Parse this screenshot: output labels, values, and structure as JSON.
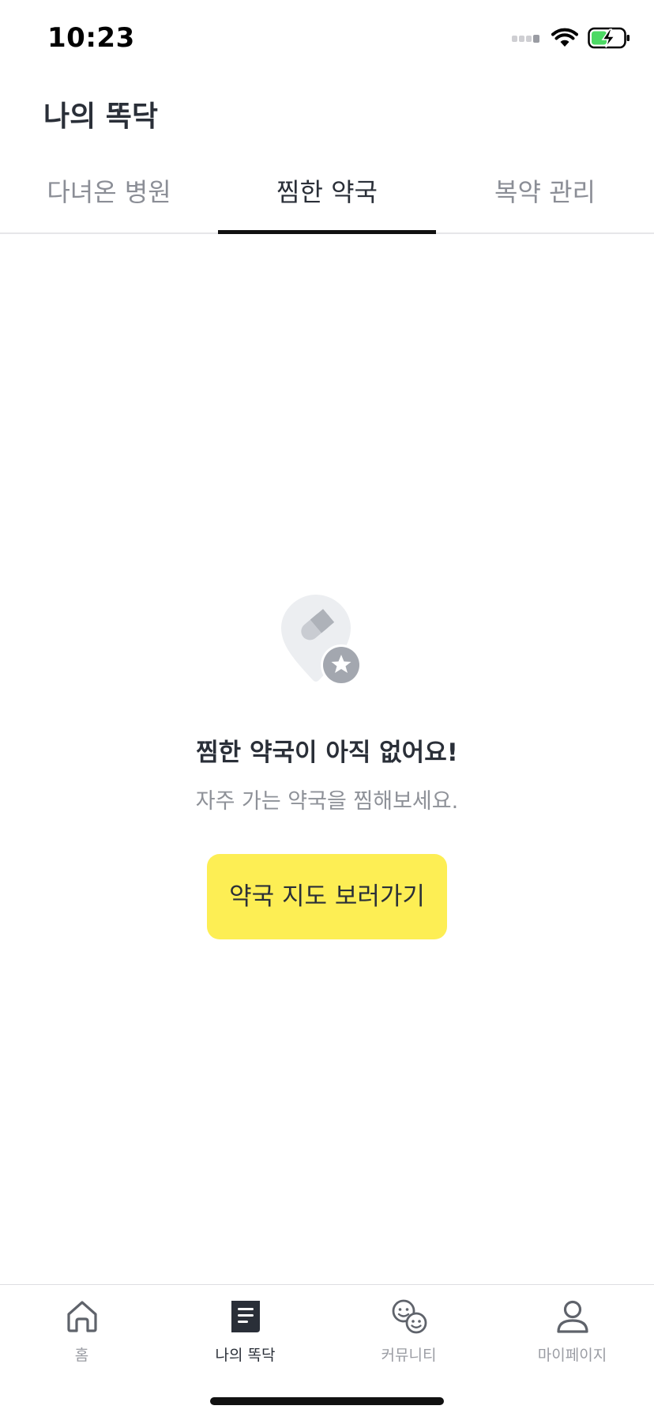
{
  "status_bar": {
    "time": "10:23"
  },
  "header": {
    "title": "나의 똑닥"
  },
  "tabs": [
    {
      "label": "다녀온 병원",
      "active": false
    },
    {
      "label": "찜한 약국",
      "active": true
    },
    {
      "label": "복약 관리",
      "active": false
    }
  ],
  "empty_state": {
    "icon": "pharmacy-pin-star-icon",
    "title": "찜한 약국이 아직 없어요!",
    "subtitle": "자주 가는 약국을 찜해보세요.",
    "button_label": "약국 지도 보러가기"
  },
  "bottom_nav": {
    "items": [
      {
        "label": "홈",
        "icon": "home-icon",
        "active": false
      },
      {
        "label": "나의 똑닥",
        "icon": "document-icon",
        "active": true
      },
      {
        "label": "커뮤니티",
        "icon": "community-faces-icon",
        "active": false
      },
      {
        "label": "마이페이지",
        "icon": "person-icon",
        "active": false
      }
    ]
  },
  "colors": {
    "accent_yellow": "#fdee54",
    "text_primary": "#2a2f38",
    "text_secondary": "#8b8e96",
    "battery_green": "#4cd964"
  }
}
